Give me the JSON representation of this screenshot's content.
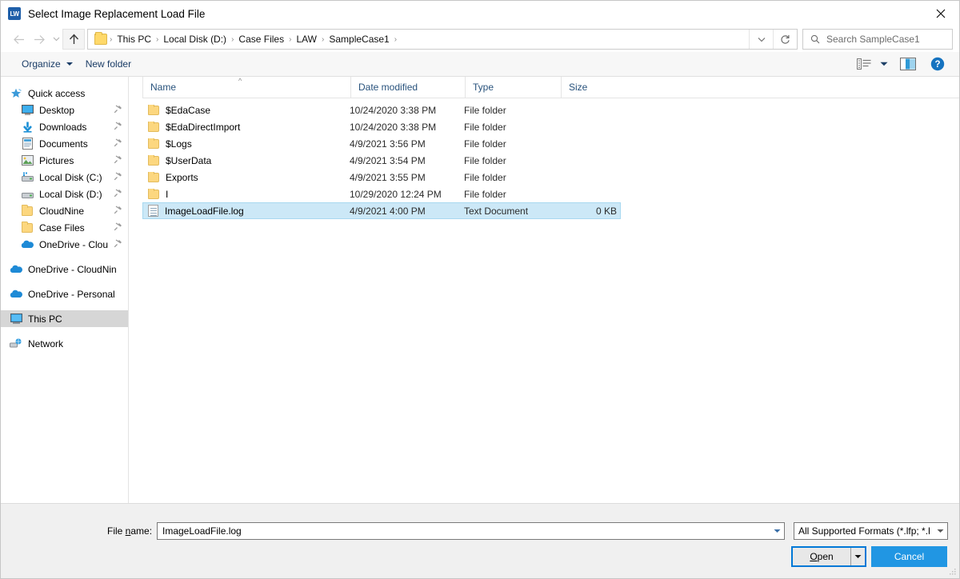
{
  "window": {
    "title": "Select Image Replacement Load File",
    "app_icon": "LW",
    "close_label": "✕"
  },
  "nav": {
    "back_icon": "back-arrow-icon",
    "forward_icon": "forward-arrow-icon",
    "recent_icon": "recent-locations-icon",
    "up_icon": "up-arrow-icon",
    "dropdown_icon": "chevron-down-icon",
    "refresh_icon": "refresh-icon",
    "breadcrumbs": [
      "This PC",
      "Local Disk (D:)",
      "Case Files",
      "LAW",
      "SampleCase1"
    ],
    "separator": "›"
  },
  "search": {
    "placeholder": "Search SampleCase1",
    "icon": "search-icon"
  },
  "toolbar": {
    "organize_label": "Organize",
    "new_folder_label": "New folder",
    "view_icon": "view-layout-icon",
    "view_caret_icon": "chevron-down-icon",
    "preview_pane_icon": "preview-pane-icon",
    "help_icon": "help-icon"
  },
  "sidebar": {
    "items": [
      {
        "label": "Quick access",
        "icon": "star-icon",
        "level": 0,
        "pinned": false,
        "selected": false
      },
      {
        "label": "Desktop",
        "icon": "desktop-icon",
        "level": 1,
        "pinned": true,
        "selected": false
      },
      {
        "label": "Downloads",
        "icon": "downloads-icon",
        "level": 1,
        "pinned": true,
        "selected": false
      },
      {
        "label": "Documents",
        "icon": "documents-icon",
        "level": 1,
        "pinned": true,
        "selected": false
      },
      {
        "label": "Pictures",
        "icon": "pictures-icon",
        "level": 1,
        "pinned": true,
        "selected": false
      },
      {
        "label": "Local Disk (C:)",
        "icon": "drive-icon",
        "level": 1,
        "pinned": true,
        "selected": false
      },
      {
        "label": "Local Disk (D:)",
        "icon": "drive-icon",
        "level": 1,
        "pinned": true,
        "selected": false
      },
      {
        "label": "CloudNine",
        "icon": "folder-icon",
        "level": 1,
        "pinned": true,
        "selected": false
      },
      {
        "label": "Case Files",
        "icon": "folder-icon",
        "level": 1,
        "pinned": true,
        "selected": false
      },
      {
        "label": "OneDrive - Clou",
        "icon": "cloud-icon",
        "level": 1,
        "pinned": true,
        "selected": false
      },
      {
        "label": "OneDrive - CloudNin",
        "icon": "cloud-icon",
        "level": 0,
        "pinned": false,
        "selected": false,
        "gap": true
      },
      {
        "label": "OneDrive - Personal",
        "icon": "cloud-icon",
        "level": 0,
        "pinned": false,
        "selected": false,
        "gap": true
      },
      {
        "label": "This PC",
        "icon": "this-pc-icon",
        "level": 0,
        "pinned": false,
        "selected": true,
        "gap": true
      },
      {
        "label": "Network",
        "icon": "network-icon",
        "level": 0,
        "pinned": false,
        "selected": false,
        "gap": true
      }
    ]
  },
  "filelist": {
    "columns": [
      "Name",
      "Date modified",
      "Type",
      "Size"
    ],
    "sort_indicator": "^",
    "rows": [
      {
        "name": "$EdaCase",
        "date": "10/24/2020 3:38 PM",
        "type": "File folder",
        "size": "",
        "icon": "folder-icon",
        "selected": false
      },
      {
        "name": "$EdaDirectImport",
        "date": "10/24/2020 3:38 PM",
        "type": "File folder",
        "size": "",
        "icon": "folder-icon",
        "selected": false
      },
      {
        "name": "$Logs",
        "date": "4/9/2021 3:56 PM",
        "type": "File folder",
        "size": "",
        "icon": "folder-icon",
        "selected": false
      },
      {
        "name": "$UserData",
        "date": "4/9/2021 3:54 PM",
        "type": "File folder",
        "size": "",
        "icon": "folder-icon",
        "selected": false
      },
      {
        "name": "Exports",
        "date": "4/9/2021 3:55 PM",
        "type": "File folder",
        "size": "",
        "icon": "folder-icon",
        "selected": false
      },
      {
        "name": "I",
        "date": "10/29/2020 12:24 PM",
        "type": "File folder",
        "size": "",
        "icon": "folder-icon",
        "selected": false
      },
      {
        "name": "ImageLoadFile.log",
        "date": "4/9/2021 4:00 PM",
        "type": "Text Document",
        "size": "0 KB",
        "icon": "text-file-icon",
        "selected": true
      }
    ]
  },
  "footer": {
    "filename_label_pre": "File ",
    "filename_label_accel": "n",
    "filename_label_post": "ame:",
    "filename_value": "ImageLoadFile.log",
    "filetype_value": "All Supported Formats (*.lfp; *.l",
    "open_label_accel": "O",
    "open_label_rest": "pen",
    "cancel_label": "Cancel",
    "dropdown_icon": "chevron-down-icon",
    "resize_grip_icon": "resize-grip-icon"
  },
  "colors": {
    "accent": "#0078d7",
    "cancel_bg": "#2196e3",
    "selection_bg": "#cce8f7",
    "sidebar_selected_bg": "#d6d6d6",
    "folder_yellow": "#fcd77f",
    "header_text": "#28527c"
  }
}
